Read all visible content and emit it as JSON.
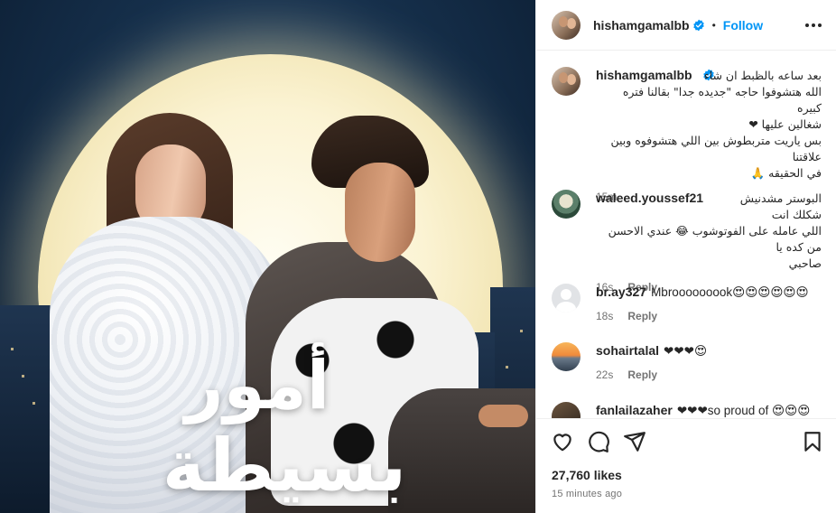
{
  "post": {
    "title_line1": "أمور",
    "title_line2": "بسيطة"
  },
  "header": {
    "username": "hishamgamalbb",
    "separator": "•",
    "follow_label": "Follow"
  },
  "caption": {
    "username": "hishamgamalbb",
    "lines": [
      "بعد ساعه بالظبط ان شاء",
      "الله هتشوفوا حاجه \"جديده جدا\" بقالنا فتره كبيره",
      "شغالين عليها ❤",
      "بس ياريت متربطوش بين اللي هتشوفوه وبين علاقتنا",
      "في الحقيقه 🙏"
    ],
    "time": "15m"
  },
  "comments": [
    {
      "username": "waleed.youssef21",
      "lines": [
        "البوستر مشدنيش شكلك انت",
        "اللي عامله على الفوتوشوب 😂 عندي الاحسن من كده يا",
        "صاحبي"
      ],
      "time": "16s",
      "reply_label": "Reply"
    },
    {
      "username": "br.ay327",
      "text": "Mbrooooooook😍😍😍😍😍😍",
      "time": "18s",
      "reply_label": "Reply"
    },
    {
      "username": "sohairtalal",
      "text": "❤❤❤😍",
      "time": "22s",
      "reply_label": "Reply"
    },
    {
      "username": "fanlailazaher",
      "text": "❤❤❤so proud of 😍😍😍"
    }
  ],
  "footer": {
    "likes": "27,760 likes",
    "time": "15 minutes ago"
  },
  "colors": {
    "accent": "#0095f6",
    "verified": "#0095f6",
    "muted": "#737373",
    "text": "#262626"
  },
  "icons": [
    "verified-badge-icon",
    "more-options-icon",
    "heart-icon",
    "comment-icon",
    "share-icon",
    "bookmark-icon"
  ]
}
